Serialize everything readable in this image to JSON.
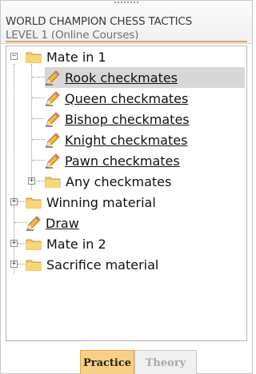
{
  "header": {
    "title": "WORLD CHAMPION CHESS TACTICS",
    "subtitle": "LEVEL 1 (Online Courses)"
  },
  "tree": {
    "nodes": [
      {
        "label": "Mate in 1",
        "type": "folder",
        "expanded": true,
        "expander": "−"
      },
      {
        "label": "Rook checkmates",
        "type": "exercise",
        "selected": true
      },
      {
        "label": "Queen checkmates",
        "type": "exercise"
      },
      {
        "label": "Bishop checkmates",
        "type": "exercise"
      },
      {
        "label": "Knight checkmates",
        "type": "exercise"
      },
      {
        "label": "Pawn checkmates",
        "type": "exercise"
      },
      {
        "label": "Any checkmates",
        "type": "folder",
        "expanded": false,
        "expander": "+"
      },
      {
        "label": "Winning material",
        "type": "folder",
        "expanded": false,
        "expander": "+"
      },
      {
        "label": "Draw",
        "type": "exercise"
      },
      {
        "label": "Mate in 2",
        "type": "folder",
        "expanded": false,
        "expander": "+"
      },
      {
        "label": "Sacrifice material",
        "type": "folder",
        "expanded": false,
        "expander": "+"
      }
    ]
  },
  "tabs": {
    "practice": "Practice",
    "theory": "Theory",
    "active": "practice"
  },
  "colors": {
    "accent_line": "#f4a23a",
    "active_tab": "#f7cf86",
    "folder": "#f3c75a",
    "selection": "#d7d7d7"
  },
  "icons": {
    "folder": "folder-icon",
    "exercise": "pencil-icon",
    "expander": "tree-expander-icon"
  }
}
